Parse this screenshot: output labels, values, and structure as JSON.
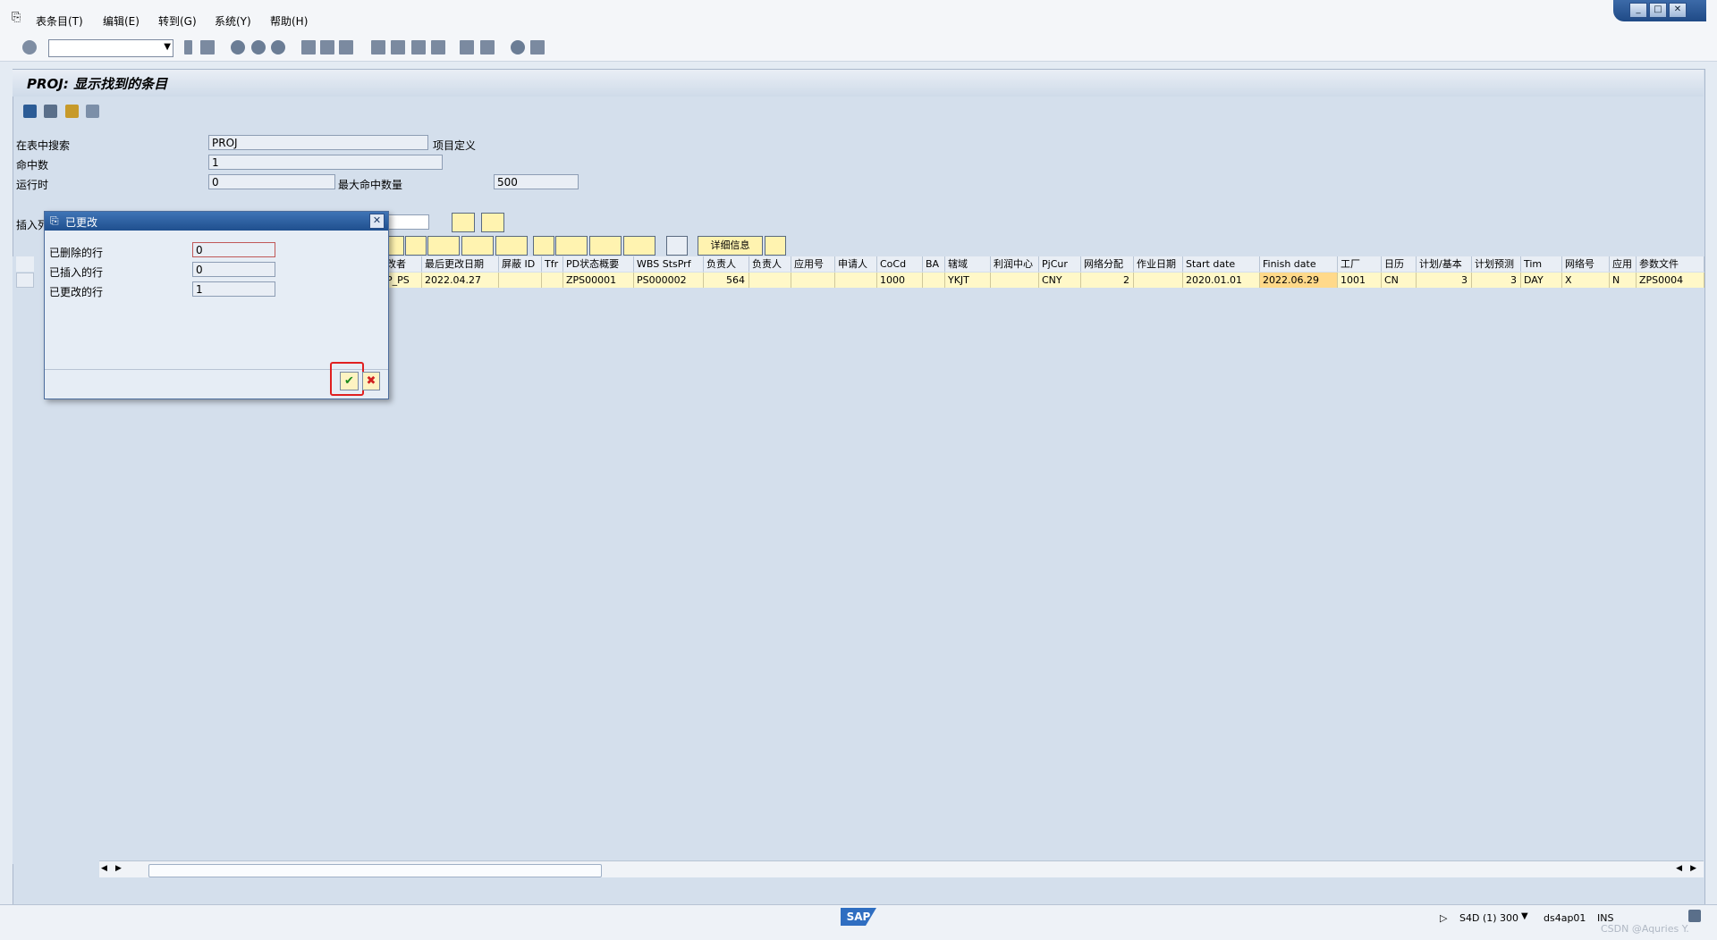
{
  "menu": [
    "表条目(T)",
    "编辑(E)",
    "转到(G)",
    "系统(Y)",
    "帮助(H)"
  ],
  "window_controls": [
    "_",
    "□",
    "✕"
  ],
  "page_title": "PROJ: 显示找到的条目",
  "form": {
    "search_label": "在表中搜索",
    "search_value": "PROJ",
    "search_desc": "项目定义",
    "hits_label": "命中数",
    "hits_value": "1",
    "runtime_label": "运行时",
    "runtime_value": "0",
    "maxhits_label": "最大命中数量",
    "maxhits_value": "500",
    "insert_label": "插入列"
  },
  "grid_toolbar": {
    "detail_label": "详细信息"
  },
  "grid": {
    "columns": [
      "改者",
      "最后更改日期",
      "屏蔽 ID",
      "Tfr",
      "PD状态概要",
      "WBS StsPrf",
      "负责人",
      "负责人",
      "应用号",
      "申请人",
      "CoCd",
      "BA",
      "辖域",
      "利润中心",
      "PjCur",
      "网络分配",
      "作业日期",
      "Start date",
      "Finish date",
      "工厂",
      "日历",
      "计划/基本",
      "计划预测",
      "Tim",
      "网络号",
      "应用",
      "参数文件"
    ],
    "row": [
      "P_PS",
      "2022.04.27",
      "",
      "",
      "ZPS00001",
      "PS000002",
      "564",
      "",
      "",
      "",
      "1000",
      "",
      "YKJT",
      "",
      "CNY",
      "2",
      "",
      "2020.01.01",
      "2022.06.29",
      "1001",
      "CN",
      "3",
      "3",
      "DAY",
      "X",
      "N",
      "ZPS0004"
    ]
  },
  "dialog": {
    "title": "已更改",
    "deleted_label": "已删除的行",
    "deleted_value": "0",
    "inserted_label": "已插入的行",
    "inserted_value": "0",
    "changed_label": "已更改的行",
    "changed_value": "1"
  },
  "status": {
    "system": "S4D (1) 300",
    "server": "ds4ap01",
    "mode": "INS",
    "logo": "SAP",
    "watermark": "CSDN @Aquries Y."
  }
}
